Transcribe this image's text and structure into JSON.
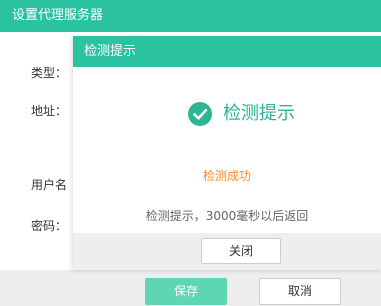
{
  "outer_dialog": {
    "title": "设置代理服务器",
    "fields": {
      "type_label": "类型：",
      "address_label": "地址：",
      "username_label": "用户名",
      "password_label": "密码："
    },
    "save_button": "保存",
    "cancel_button": "取消"
  },
  "test_dialog": {
    "title": "检测提示",
    "status_icon": "check-circle-icon",
    "status_heading": "检测提示",
    "result_text": "检测成功",
    "info_text": "检测提示，3000毫秒以后返回",
    "close_button": "关闭"
  },
  "colors": {
    "accent": "#2bc29f",
    "success_text": "#f28b30",
    "save_button": "#5fd6b3"
  }
}
